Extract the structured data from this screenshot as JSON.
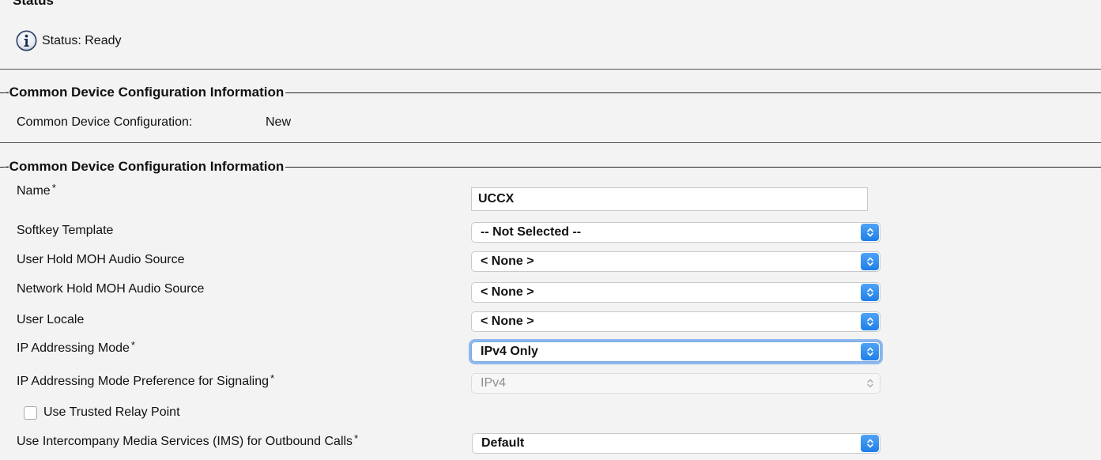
{
  "status_section": {
    "heading": "Status",
    "status_text": "Status: Ready"
  },
  "info_section": {
    "legend": "Common Device Configuration Information",
    "config_label": "Common Device Configuration:",
    "config_value": "New"
  },
  "form_section": {
    "legend": "Common Device Configuration Information",
    "name_label": "Name",
    "name_value": "UCCX",
    "softkey_label": "Softkey Template",
    "softkey_value": "-- Not Selected --",
    "user_hold_label": "User Hold MOH Audio Source",
    "user_hold_value": "< None >",
    "network_hold_label": "Network Hold MOH Audio Source",
    "network_hold_value": "< None >",
    "user_locale_label": "User Locale",
    "user_locale_value": "< None >",
    "ip_mode_label": "IP Addressing Mode",
    "ip_mode_value": "IPv4 Only",
    "ip_signaling_label": "IP Addressing Mode Preference for Signaling",
    "ip_signaling_value": "IPv4",
    "trusted_relay_label": "Use Trusted Relay Point",
    "trusted_relay_checked": false,
    "ims_label": "Use Intercompany Media Services (IMS) for Outbound Calls",
    "ims_value": "Default",
    "required_marker": "*"
  },
  "icons": {
    "info": "info-icon",
    "select_arrows": "chevron-up-down-icon"
  },
  "colors": {
    "background": "#f3f3f3",
    "select_accent": "#2a88ee",
    "focus_ring": "#8db8ee"
  }
}
